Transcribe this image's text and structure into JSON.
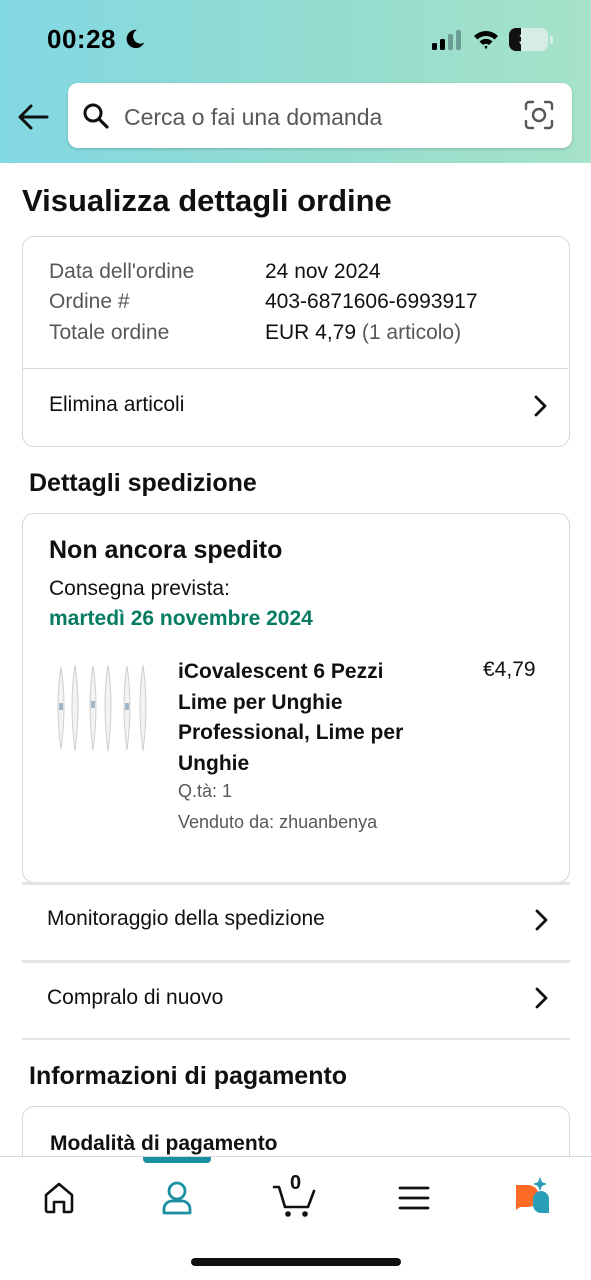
{
  "status_bar": {
    "time": "00:28",
    "battery": "31",
    "battery_level": 0.31
  },
  "search": {
    "placeholder": "Cerca o fai una domanda"
  },
  "page": {
    "title": "Visualizza dettagli ordine"
  },
  "order_summary": {
    "date_label": "Data dell'ordine",
    "date_value": "24 nov 2024",
    "number_label": "Ordine #",
    "number_value": "403-6871606-6993917",
    "total_label": "Totale ordine",
    "total_value": "EUR 4,79",
    "total_items": "(1 articolo)",
    "delete_items": "Elimina articoli"
  },
  "shipment": {
    "section_title": "Dettagli spedizione",
    "status": "Non ancora spedito",
    "delivery_label": "Consegna prevista:",
    "delivery_date": "martedì 26 novembre 2024",
    "product_title": "iCovalescent 6 Pezzi Lime per Unghie Professional, Lime per Unghie",
    "product_price": "€4,79",
    "quantity": "Q.tà: 1",
    "seller": "Venduto da: zhuanbenya",
    "track_label": "Monitoraggio della spedizione",
    "buy_again_label": "Compralo di nuovo"
  },
  "payment": {
    "section_title": "Informazioni di pagamento",
    "method_label": "Modalità di pagamento"
  },
  "bottom_nav": {
    "cart_count": "0",
    "active_color": "#1a8fa1"
  },
  "colors": {
    "header_gradient_start": "#82d8e3",
    "header_gradient_end": "#a6e3c8",
    "delivery_green": "#067d62",
    "rufus_orange": "#fe6b24",
    "rufus_teal": "#2a9db8"
  },
  "icons": [
    "moon-icon",
    "signal-icon",
    "wifi-icon",
    "battery-icon",
    "back-arrow-icon",
    "search-icon",
    "camera-lens-icon",
    "chevron-right-icon",
    "home-icon",
    "account-icon",
    "cart-icon",
    "menu-icon",
    "rufus-icon"
  ]
}
